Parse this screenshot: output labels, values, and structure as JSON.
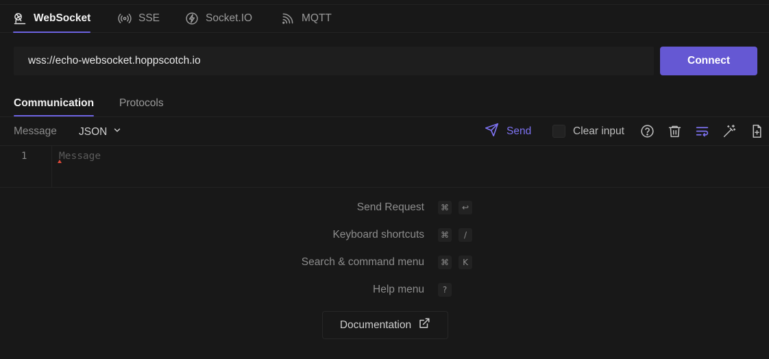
{
  "protocol_tabs": [
    {
      "label": "WebSocket",
      "icon": "websocket-icon",
      "active": true
    },
    {
      "label": "SSE",
      "icon": "sse-icon",
      "active": false
    },
    {
      "label": "Socket.IO",
      "icon": "socketio-icon",
      "active": false
    },
    {
      "label": "MQTT",
      "icon": "mqtt-icon",
      "active": false
    }
  ],
  "url": {
    "value": "wss://echo-websocket.hoppscotch.io"
  },
  "connect_label": "Connect",
  "communication_tabs": [
    {
      "label": "Communication",
      "active": true
    },
    {
      "label": "Protocols",
      "active": false
    }
  ],
  "message_toolbar": {
    "message_label": "Message",
    "format": "JSON",
    "send_label": "Send",
    "clear_input_label": "Clear input",
    "clear_input_checked": false
  },
  "editor": {
    "line_number": "1",
    "placeholder": "Message"
  },
  "shortcuts": [
    {
      "label": "Send Request",
      "keys": [
        "⌘",
        "↩"
      ]
    },
    {
      "label": "Keyboard shortcuts",
      "keys": [
        "⌘",
        "/"
      ]
    },
    {
      "label": "Search & command menu",
      "keys": [
        "⌘",
        "K"
      ]
    },
    {
      "label": "Help menu",
      "keys": [
        "?"
      ]
    }
  ],
  "documentation_label": "Documentation",
  "colors": {
    "accent": "#6558d3",
    "accent_text": "#7d72f0",
    "background": "#181818"
  }
}
